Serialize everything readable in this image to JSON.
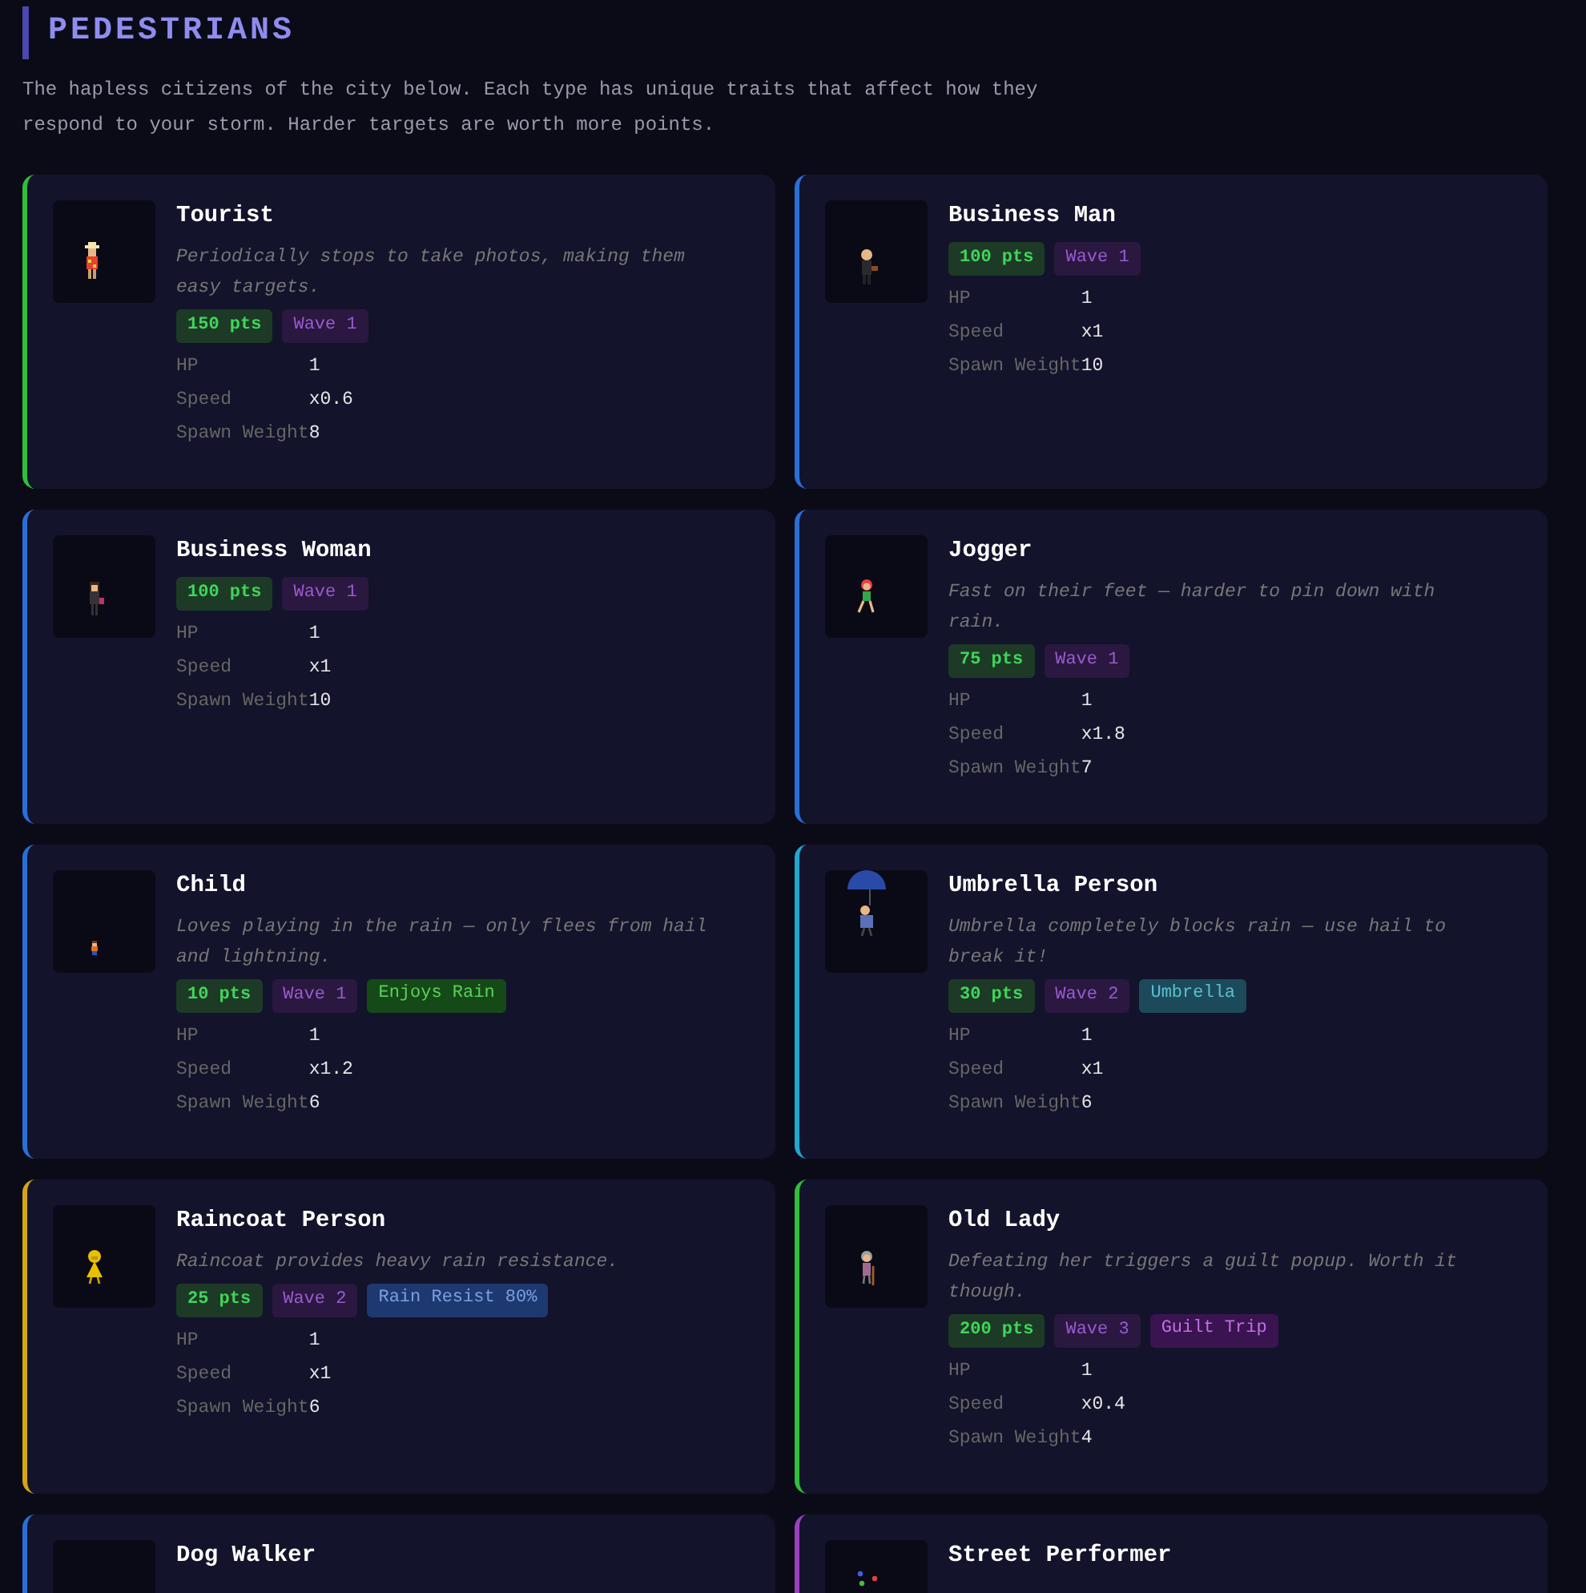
{
  "header": {
    "title": "PEDESTRIANS",
    "intro": "The hapless citizens of the city below. Each type has unique traits that affect how they respond to your storm. Harder targets are worth more points."
  },
  "cards": [
    {
      "name": "Tourist",
      "color": "#2fbf3a",
      "kind": "tourist",
      "description": "Periodically stops to take photos, making them easy targets.",
      "points": "150 pts",
      "wave": "Wave 1",
      "stats": [
        {
          "label": "HP",
          "value": "1"
        },
        {
          "label": "Speed",
          "value": "x0.6"
        },
        {
          "label": "Spawn Weight",
          "value": "8"
        }
      ]
    },
    {
      "name": "Business Man",
      "color": "#2a6fd6",
      "kind": "businessman",
      "points": "100 pts",
      "wave": "Wave 1",
      "stats": [
        {
          "label": "HP",
          "value": "1"
        },
        {
          "label": "Speed",
          "value": "x1"
        },
        {
          "label": "Spawn Weight",
          "value": "10"
        }
      ]
    },
    {
      "name": "Business Woman",
      "color": "#2a6fd6",
      "kind": "businesswoman",
      "points": "100 pts",
      "wave": "Wave 1",
      "stats": [
        {
          "label": "HP",
          "value": "1"
        },
        {
          "label": "Speed",
          "value": "x1"
        },
        {
          "label": "Spawn Weight",
          "value": "10"
        }
      ]
    },
    {
      "name": "Jogger",
      "color": "#2a6fd6",
      "kind": "jogger",
      "description": "Fast on their feet — harder to pin down with rain.",
      "points": "75 pts",
      "wave": "Wave 1",
      "stats": [
        {
          "label": "HP",
          "value": "1"
        },
        {
          "label": "Speed",
          "value": "x1.8"
        },
        {
          "label": "Spawn Weight",
          "value": "7"
        }
      ]
    },
    {
      "name": "Child",
      "color": "#2a6fd6",
      "kind": "child",
      "description": "Loves playing in the rain — only flees from hail and lightning.",
      "points": "10 pts",
      "wave": "Wave 1",
      "trait": {
        "label": "Enjoys Rain",
        "kind": "rain"
      },
      "stats": [
        {
          "label": "HP",
          "value": "1"
        },
        {
          "label": "Speed",
          "value": "x1.2"
        },
        {
          "label": "Spawn Weight",
          "value": "6"
        }
      ]
    },
    {
      "name": "Umbrella Person",
      "color": "#1fa8d0",
      "kind": "umbrella",
      "description": "Umbrella completely blocks rain — use hail to break it!",
      "points": "30 pts",
      "wave": "Wave 2",
      "trait": {
        "label": "Umbrella",
        "kind": "umbrella"
      },
      "stats": [
        {
          "label": "HP",
          "value": "1"
        },
        {
          "label": "Speed",
          "value": "x1"
        },
        {
          "label": "Spawn Weight",
          "value": "6"
        }
      ]
    },
    {
      "name": "Raincoat Person",
      "color": "#d4a514",
      "kind": "raincoat",
      "description": "Raincoat provides heavy rain resistance.",
      "points": "25 pts",
      "wave": "Wave 2",
      "trait": {
        "label": "Rain Resist 80%",
        "kind": "resist"
      },
      "stats": [
        {
          "label": "HP",
          "value": "1"
        },
        {
          "label": "Speed",
          "value": "x1"
        },
        {
          "label": "Spawn Weight",
          "value": "6"
        }
      ]
    },
    {
      "name": "Old Lady",
      "color": "#2fbf3a",
      "kind": "oldlady",
      "description": "Defeating her triggers a guilt popup. Worth it though.",
      "points": "200 pts",
      "wave": "Wave 3",
      "trait": {
        "label": "Guilt Trip",
        "kind": "guilt"
      },
      "stats": [
        {
          "label": "HP",
          "value": "1"
        },
        {
          "label": "Speed",
          "value": "x0.4"
        },
        {
          "label": "Spawn Weight",
          "value": "4"
        }
      ]
    },
    {
      "name": "Dog Walker",
      "color": "#2a6fd6",
      "kind": "dogwalker"
    },
    {
      "name": "Street Performer",
      "color": "#9b3fc0",
      "kind": "performer"
    }
  ]
}
